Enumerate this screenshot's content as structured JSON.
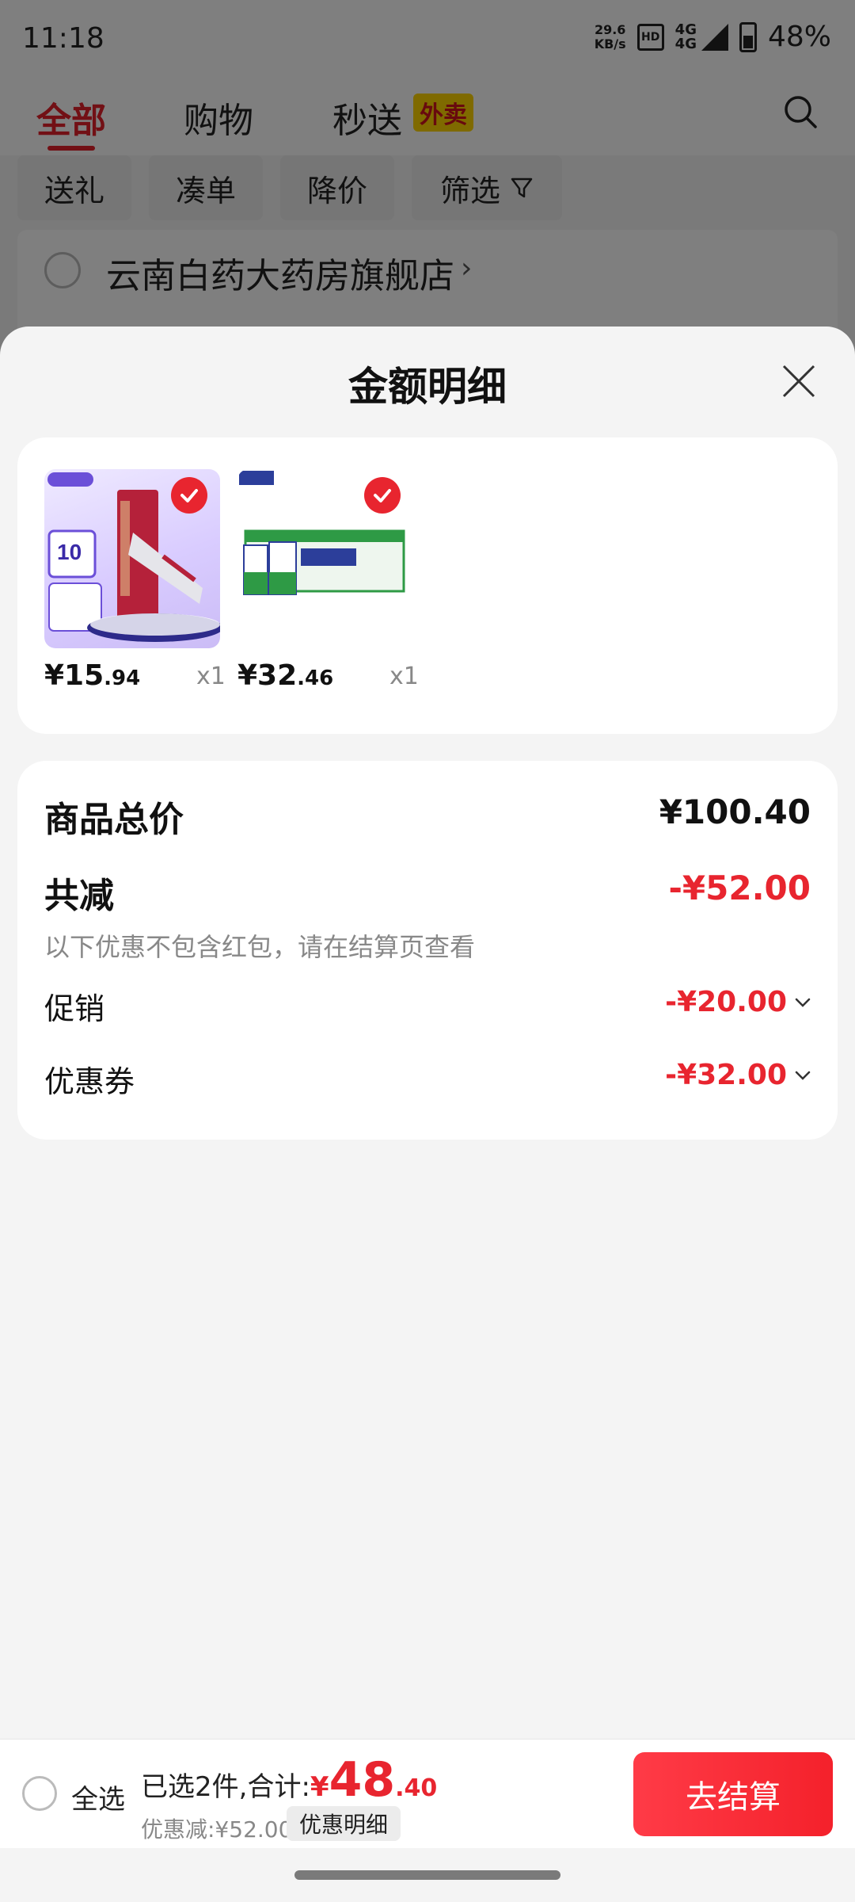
{
  "status_bar": {
    "time": "11:18",
    "net_speed_value": "29.6",
    "net_speed_unit": "KB/s",
    "network_1": "4G",
    "network_2": "4G",
    "battery": "48%"
  },
  "nav_tabs": {
    "all": "全部",
    "shopping": "购物",
    "fast_delivery": "秒送",
    "takeaway_badge": "外卖"
  },
  "filters": {
    "gift": "送礼",
    "bundle": "凑单",
    "price_drop": "降价",
    "filter": "筛选"
  },
  "store": {
    "name": "云南白药大药房旗舰店"
  },
  "sheet": {
    "title": "金额明细",
    "items": [
      {
        "price_int": "¥15",
        "price_dec": ".94",
        "qty": "x1"
      },
      {
        "price_int": "¥32",
        "price_dec": ".46",
        "qty": "x1"
      }
    ],
    "summary": {
      "total_label": "商品总价",
      "total_value": "¥100.40",
      "reduce_label": "共减",
      "reduce_value": "-¥52.00",
      "note": "以下优惠不包含红包，请在结算页查看",
      "promo_label": "促销",
      "promo_value": "-¥20.00",
      "coupon_label": "优惠券",
      "coupon_value": "-¥32.00"
    }
  },
  "bottom_bar": {
    "select_all": "全选",
    "selected_text": "已选2件,合计:",
    "total_sign": "¥",
    "total_int": "48",
    "total_dec": ".40",
    "discount_text": "优惠减:¥52.00",
    "detail_button": "优惠明细",
    "checkout_button": "去结算"
  },
  "colors": {
    "accent_red": "#e8252f",
    "takeaway_yellow": "#ffd400"
  }
}
